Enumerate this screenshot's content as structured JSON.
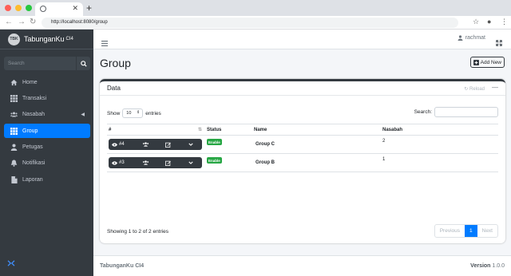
{
  "browser": {
    "dots": [
      "#ff5f57",
      "#febc2e",
      "#28c840"
    ],
    "tab_close": "✕",
    "new_tab": "+",
    "url": "http://localhost:8080/group"
  },
  "sidebar": {
    "brand": "TabunganKu",
    "brand_suffix": "CI4",
    "logo_text": "TBK",
    "search_placeholder": "Search",
    "items": [
      {
        "label": "Home",
        "icon": "home-icon"
      },
      {
        "label": "Transaksi",
        "icon": "grid-icon"
      },
      {
        "label": "Nasabah",
        "icon": "users-icon",
        "caret": "◀"
      },
      {
        "label": "Group",
        "icon": "grid-icon",
        "active": true
      },
      {
        "label": "Petugas",
        "icon": "user-icon"
      },
      {
        "label": "Notifikasi",
        "icon": "bell-icon"
      },
      {
        "label": "Laporan",
        "icon": "file-icon"
      }
    ],
    "footer_icon": "collapse-arrows-icon"
  },
  "topnav": {
    "user": "rachmat"
  },
  "page": {
    "title": "Group",
    "add_button": "Add New"
  },
  "card": {
    "title": "Data",
    "reload": "Reload",
    "collapse": "—",
    "show_label": "Show",
    "entries_label": "entries",
    "page_size": "10",
    "search_label": "Search:",
    "columns": [
      "#",
      "Status",
      "Name",
      "Nasabah"
    ],
    "rows": [
      {
        "id": "#4",
        "status": "Enable",
        "name": "Group C",
        "nasabah": "2"
      },
      {
        "id": "#3",
        "status": "Enable",
        "name": "Group B",
        "nasabah": "1"
      }
    ],
    "info": "Showing 1 to 2 of 2 entries",
    "pager": {
      "prev": "Previous",
      "current": "1",
      "next": "Next"
    }
  },
  "footer": {
    "left": "TabunganKu CI4",
    "version_label": "Version",
    "version": "1.0.0"
  },
  "colors": {
    "sidebar_bg": "#343a40",
    "accent": "#007bff",
    "badge_green": "#28a745",
    "content_bg": "#f4f6f9"
  }
}
